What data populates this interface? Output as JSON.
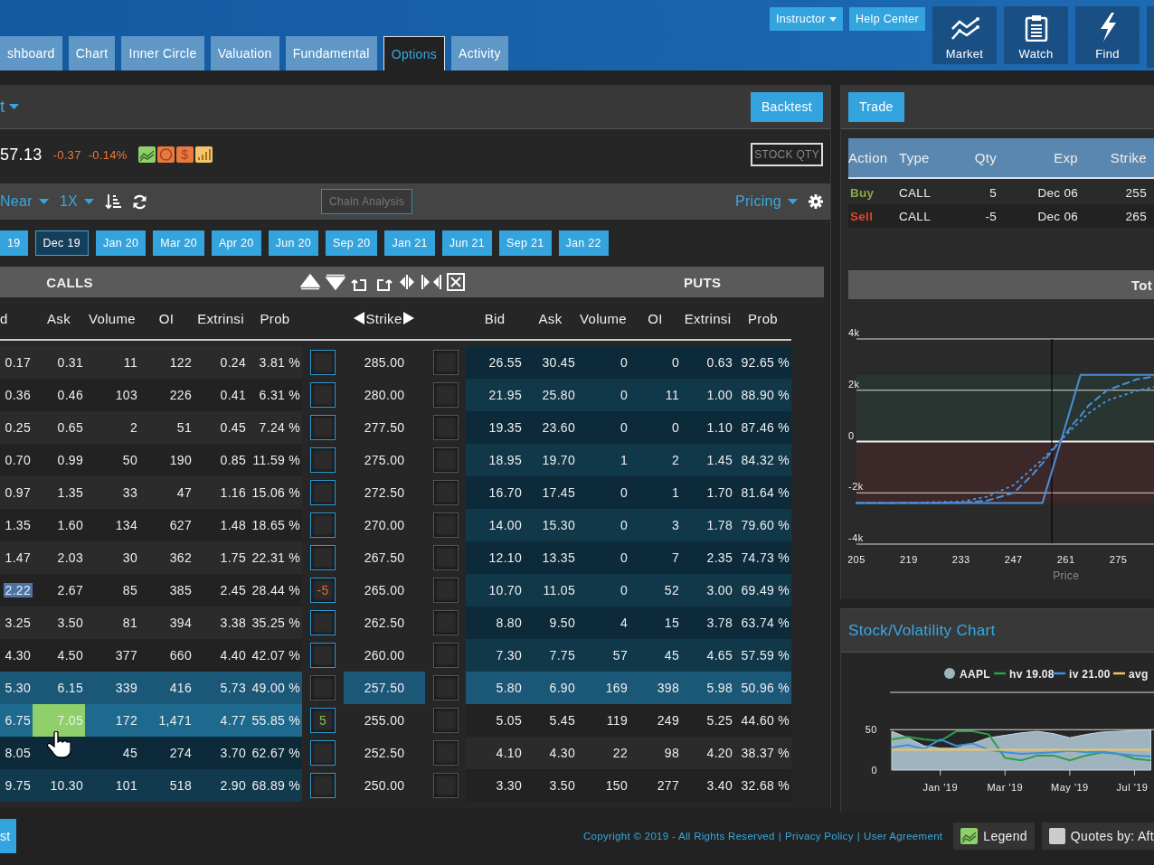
{
  "nav": {
    "tabs": [
      {
        "label": "shboard",
        "selected": false
      },
      {
        "label": "Chart",
        "selected": false
      },
      {
        "label": "Inner Circle",
        "selected": false
      },
      {
        "label": "Valuation",
        "selected": false
      },
      {
        "label": "Fundamental",
        "selected": false
      },
      {
        "label": "Options",
        "selected": true
      },
      {
        "label": "Activity",
        "selected": false
      }
    ],
    "buttons": [
      {
        "label": "Instructor",
        "dropdown": true
      },
      {
        "label": "Help Center",
        "dropdown": false
      }
    ],
    "tiles": [
      {
        "label": "Market",
        "kind": "market"
      },
      {
        "label": "Watch",
        "kind": "watch"
      },
      {
        "label": "Find",
        "kind": "find"
      }
    ]
  },
  "options": {
    "symbol": "t",
    "backtest": "Backtest",
    "quote": {
      "price": "57.13",
      "change": "-0.37",
      "change_pct": "-0.14%",
      "badges": [
        {
          "kind": "chart"
        },
        {
          "kind": "circle"
        },
        {
          "kind": "dollar",
          "label": "$"
        },
        {
          "kind": "bars"
        }
      ],
      "stock_qty": "STOCK QTY"
    },
    "toolbar": {
      "range": "Near",
      "multiplier": "1X",
      "chain_analysis": "Chain Analysis",
      "pricing": "Pricing"
    },
    "expirations": [
      {
        "label": "19",
        "selected": false
      },
      {
        "label": "Dec 19",
        "selected": true
      },
      {
        "label": "Jan 20",
        "selected": false
      },
      {
        "label": "Mar 20",
        "selected": false
      },
      {
        "label": "Apr 20",
        "selected": false
      },
      {
        "label": "Jun 20",
        "selected": false
      },
      {
        "label": "Sep 20",
        "selected": false
      },
      {
        "label": "Jan 21",
        "selected": false
      },
      {
        "label": "Jun 21",
        "selected": false
      },
      {
        "label": "Sep 21",
        "selected": false
      },
      {
        "label": "Jan 22",
        "selected": false
      }
    ],
    "calls_title": "CALLS",
    "puts_title": "PUTS",
    "call_columns": [
      "d",
      "Ask",
      "Volume",
      "OI",
      "Extrinsi",
      "Prob"
    ],
    "strike_column": "Strike",
    "put_columns": [
      "Bid",
      "Ask",
      "Volume",
      "OI",
      "Extrinsi",
      "Prob"
    ],
    "rows": [
      {
        "strike": "285.00",
        "calls": [
          "0.17",
          "0.31",
          "11",
          "122",
          "0.24",
          "3.81 %"
        ],
        "puts": [
          "26.55",
          "30.45",
          "0",
          "0",
          "0.63",
          "92.65 %"
        ],
        "call_itm": false,
        "call_near": false,
        "put_itm": true,
        "put_near": false,
        "atm": false,
        "call_bid_selected": false,
        "call_ask_hover": false,
        "cursor": false
      },
      {
        "strike": "280.00",
        "calls": [
          "0.36",
          "0.46",
          "103",
          "226",
          "0.41",
          "6.31 %"
        ],
        "puts": [
          "21.95",
          "25.80",
          "0",
          "11",
          "1.00",
          "88.90 %"
        ],
        "call_itm": false,
        "call_near": false,
        "put_itm": true,
        "put_near": false,
        "atm": false,
        "call_bid_selected": false,
        "call_ask_hover": false,
        "cursor": false
      },
      {
        "strike": "277.50",
        "calls": [
          "0.25",
          "0.65",
          "2",
          "51",
          "0.45",
          "7.24 %"
        ],
        "puts": [
          "19.35",
          "23.60",
          "0",
          "0",
          "1.10",
          "87.46 %"
        ],
        "call_itm": false,
        "call_near": false,
        "put_itm": true,
        "put_near": false,
        "atm": false,
        "call_bid_selected": false,
        "call_ask_hover": false,
        "cursor": false
      },
      {
        "strike": "275.00",
        "calls": [
          "0.70",
          "0.99",
          "50",
          "190",
          "0.85",
          "11.59 %"
        ],
        "puts": [
          "18.95",
          "19.70",
          "1",
          "2",
          "1.45",
          "84.32 %"
        ],
        "call_itm": false,
        "call_near": false,
        "put_itm": true,
        "put_near": false,
        "atm": false,
        "call_bid_selected": false,
        "call_ask_hover": false,
        "cursor": false
      },
      {
        "strike": "272.50",
        "calls": [
          "0.97",
          "1.35",
          "33",
          "47",
          "1.16",
          "15.06 %"
        ],
        "puts": [
          "16.70",
          "17.45",
          "0",
          "1",
          "1.70",
          "81.64 %"
        ],
        "call_itm": false,
        "call_near": false,
        "put_itm": true,
        "put_near": false,
        "atm": false,
        "call_bid_selected": false,
        "call_ask_hover": false,
        "cursor": false
      },
      {
        "strike": "270.00",
        "calls": [
          "1.35",
          "1.60",
          "134",
          "627",
          "1.48",
          "18.65 %"
        ],
        "puts": [
          "14.00",
          "15.30",
          "0",
          "3",
          "1.78",
          "79.60 %"
        ],
        "call_itm": false,
        "call_near": false,
        "put_itm": true,
        "put_near": false,
        "atm": false,
        "call_bid_selected": false,
        "call_ask_hover": false,
        "cursor": false
      },
      {
        "strike": "267.50",
        "calls": [
          "1.47",
          "2.03",
          "30",
          "362",
          "1.75",
          "22.31 %"
        ],
        "puts": [
          "12.10",
          "13.35",
          "0",
          "7",
          "2.35",
          "74.73 %"
        ],
        "call_itm": false,
        "call_near": false,
        "put_itm": true,
        "put_near": false,
        "atm": false,
        "call_bid_selected": false,
        "call_ask_hover": false,
        "cursor": false
      },
      {
        "strike": "265.00",
        "calls": [
          "2.22",
          "2.67",
          "85",
          "385",
          "2.45",
          "28.44 %"
        ],
        "puts": [
          "10.70",
          "11.05",
          "0",
          "52",
          "3.00",
          "69.49 %"
        ],
        "call_itm": false,
        "call_near": false,
        "put_itm": true,
        "put_near": false,
        "atm": false,
        "call_leg": {
          "qty": "-5",
          "buy": false
        },
        "call_bid_selected": true,
        "call_ask_hover": false,
        "cursor": false
      },
      {
        "strike": "262.50",
        "calls": [
          "3.25",
          "3.50",
          "81",
          "394",
          "3.38",
          "35.25 %"
        ],
        "puts": [
          "8.80",
          "9.50",
          "4",
          "15",
          "3.78",
          "63.74 %"
        ],
        "call_itm": false,
        "call_near": false,
        "put_itm": true,
        "put_near": false,
        "atm": false,
        "call_bid_selected": false,
        "call_ask_hover": false,
        "cursor": false
      },
      {
        "strike": "260.00",
        "calls": [
          "4.30",
          "4.50",
          "377",
          "660",
          "4.40",
          "42.07 %"
        ],
        "puts": [
          "7.30",
          "7.75",
          "57",
          "45",
          "4.65",
          "57.59 %"
        ],
        "call_itm": false,
        "call_near": false,
        "put_itm": true,
        "put_near": false,
        "atm": false,
        "call_bid_selected": false,
        "call_ask_hover": false,
        "cursor": false
      },
      {
        "strike": "257.50",
        "calls": [
          "5.30",
          "6.15",
          "339",
          "416",
          "5.73",
          "49.00 %"
        ],
        "puts": [
          "5.80",
          "6.90",
          "169",
          "398",
          "5.98",
          "50.96 %"
        ],
        "call_itm": true,
        "call_near": true,
        "put_itm": true,
        "put_near": true,
        "atm": true,
        "call_bid_selected": false,
        "call_ask_hover": false,
        "cursor": false
      },
      {
        "strike": "255.00",
        "calls": [
          "6.75",
          "7.05",
          "172",
          "1,471",
          "4.77",
          "55.85 %"
        ],
        "puts": [
          "5.05",
          "5.45",
          "119",
          "249",
          "5.25",
          "44.60 %"
        ],
        "call_itm": true,
        "call_near": true,
        "put_itm": false,
        "put_near": false,
        "atm": false,
        "call_leg": {
          "qty": "5",
          "buy": true
        },
        "call_bid_selected": false,
        "call_ask_hover": true,
        "cursor": false
      },
      {
        "strike": "252.50",
        "calls": [
          "8.05",
          "45",
          "274",
          "3.70",
          "62.67 %"
        ],
        "puts": [
          "4.10",
          "4.30",
          "22",
          "98",
          "4.20",
          "38.37 %"
        ],
        "call_itm": true,
        "call_near": false,
        "put_itm": false,
        "put_near": false,
        "atm": false,
        "call_bid_selected": false,
        "call_ask_hover": false,
        "cursor": true
      },
      {
        "strike": "250.00",
        "calls": [
          "9.75",
          "10.30",
          "101",
          "518",
          "2.90",
          "68.89 %"
        ],
        "puts": [
          "3.30",
          "3.50",
          "150",
          "277",
          "3.40",
          "32.68 %"
        ],
        "call_itm": true,
        "call_near": false,
        "put_itm": false,
        "put_near": false,
        "atm": false,
        "call_bid_selected": false,
        "call_ask_hover": false,
        "cursor": false
      }
    ]
  },
  "trade": {
    "button": "Trade",
    "columns": [
      "Action",
      "Type",
      "Qty",
      "Exp",
      "Strike"
    ],
    "legs": [
      {
        "action": "Buy",
        "buy": true,
        "type": "CALL",
        "qty": "5",
        "exp": "Dec 06",
        "strike": "255"
      },
      {
        "action": "Sell",
        "buy": false,
        "type": "CALL",
        "qty": "-5",
        "exp": "Dec 06",
        "strike": "265"
      }
    ],
    "chart_title": "Tot",
    "chart_data": {
      "type": "line",
      "xlabel": "Price",
      "x": [
        205,
        219,
        233,
        240,
        247,
        252,
        254.7,
        256,
        259.3,
        263,
        264.9,
        267,
        272,
        280,
        285
      ],
      "series": [
        {
          "color": "#4a8fd8",
          "line_style": "solid",
          "values": [
            -2400,
            -2400,
            -2400,
            -2400,
            -2400,
            -2400,
            -2400,
            -1760,
            -150,
            1670,
            2600,
            2600,
            2600,
            2600,
            2600
          ]
        },
        {
          "color": "#4a8fd8",
          "line_style": "dashed",
          "values": [
            -2400,
            -2400,
            -2390,
            -2300,
            -2000,
            -1300,
            -850,
            -600,
            0,
            700,
            1000,
            1400,
            2000,
            2430,
            2540
          ]
        },
        {
          "color": "#4a8fd8",
          "line_style": "dotted",
          "values": [
            -2400,
            -2390,
            -2340,
            -2150,
            -1700,
            -1050,
            -700,
            -500,
            0,
            550,
            800,
            1100,
            1600,
            1980,
            2140
          ]
        }
      ],
      "xlim": [
        205,
        285
      ],
      "ylim": [
        -4000,
        4000
      ],
      "xticks": [
        205,
        219,
        233,
        247,
        261,
        275
      ],
      "yticks": [
        {
          "value": 4000,
          "label": "4k"
        },
        {
          "value": 2000,
          "label": "2k"
        },
        {
          "value": 0,
          "label": "0"
        },
        {
          "value": -2000,
          "label": "-2k"
        },
        {
          "value": -4000,
          "label": "-4k"
        }
      ],
      "ref_lines": [
        {
          "axis": "x",
          "value": 257.2,
          "color": "#000000"
        }
      ],
      "bands": [
        {
          "axis": "y",
          "from": 0,
          "to": 2600,
          "color": "#283530"
        },
        {
          "axis": "y",
          "from": -2400,
          "to": 0,
          "color": "#3d2829"
        }
      ]
    }
  },
  "volatility": {
    "title": "Stock/Volatility Chart",
    "chart_data": {
      "type": "line",
      "categories": [
        null,
        null,
        null,
        "Jan '19",
        null,
        null,
        null,
        "Mar '19",
        null,
        null,
        null,
        "May '19",
        null,
        null,
        null,
        "Jul '19",
        null
      ],
      "series": [
        {
          "name": "AAPL",
          "color": "#9fb4be",
          "type": "area",
          "values": [
            48,
            40,
            30,
            27,
            27,
            33,
            40,
            43,
            46,
            48,
            45,
            40,
            44,
            47,
            48,
            49,
            50
          ]
        },
        {
          "name": "hv 19.08",
          "color": "#2e9e4a",
          "type": "line",
          "values": [
            38,
            41,
            38,
            36,
            48,
            48,
            44,
            15,
            12,
            18,
            18,
            12,
            18,
            22,
            20,
            14,
            12
          ]
        },
        {
          "name": "iv 21.00",
          "color": "#3d8fe0",
          "type": "line",
          "values": [
            28,
            31,
            26,
            38,
            30,
            33,
            25,
            22,
            20,
            21,
            22,
            24,
            22,
            23,
            20,
            18,
            17
          ]
        },
        {
          "name": "avg",
          "color": "#f2c462",
          "type": "line",
          "values": [
            25,
            25,
            25,
            25,
            25,
            25,
            25,
            25,
            25,
            25,
            25,
            25,
            25,
            25,
            25,
            25,
            25
          ]
        }
      ],
      "ylim": [
        0,
        95
      ],
      "yticks": [
        0,
        50
      ],
      "legend": true
    }
  },
  "footer": {
    "button": "st",
    "copyright": "Copyright © 2019 - All Rights Reserved",
    "links": [
      {
        "separator": "|",
        "label": "Privacy Policy"
      },
      {
        "separator": "|",
        "label": "User Agreement"
      }
    ],
    "legend": "Legend",
    "quotes": "Quotes by: Aft"
  }
}
